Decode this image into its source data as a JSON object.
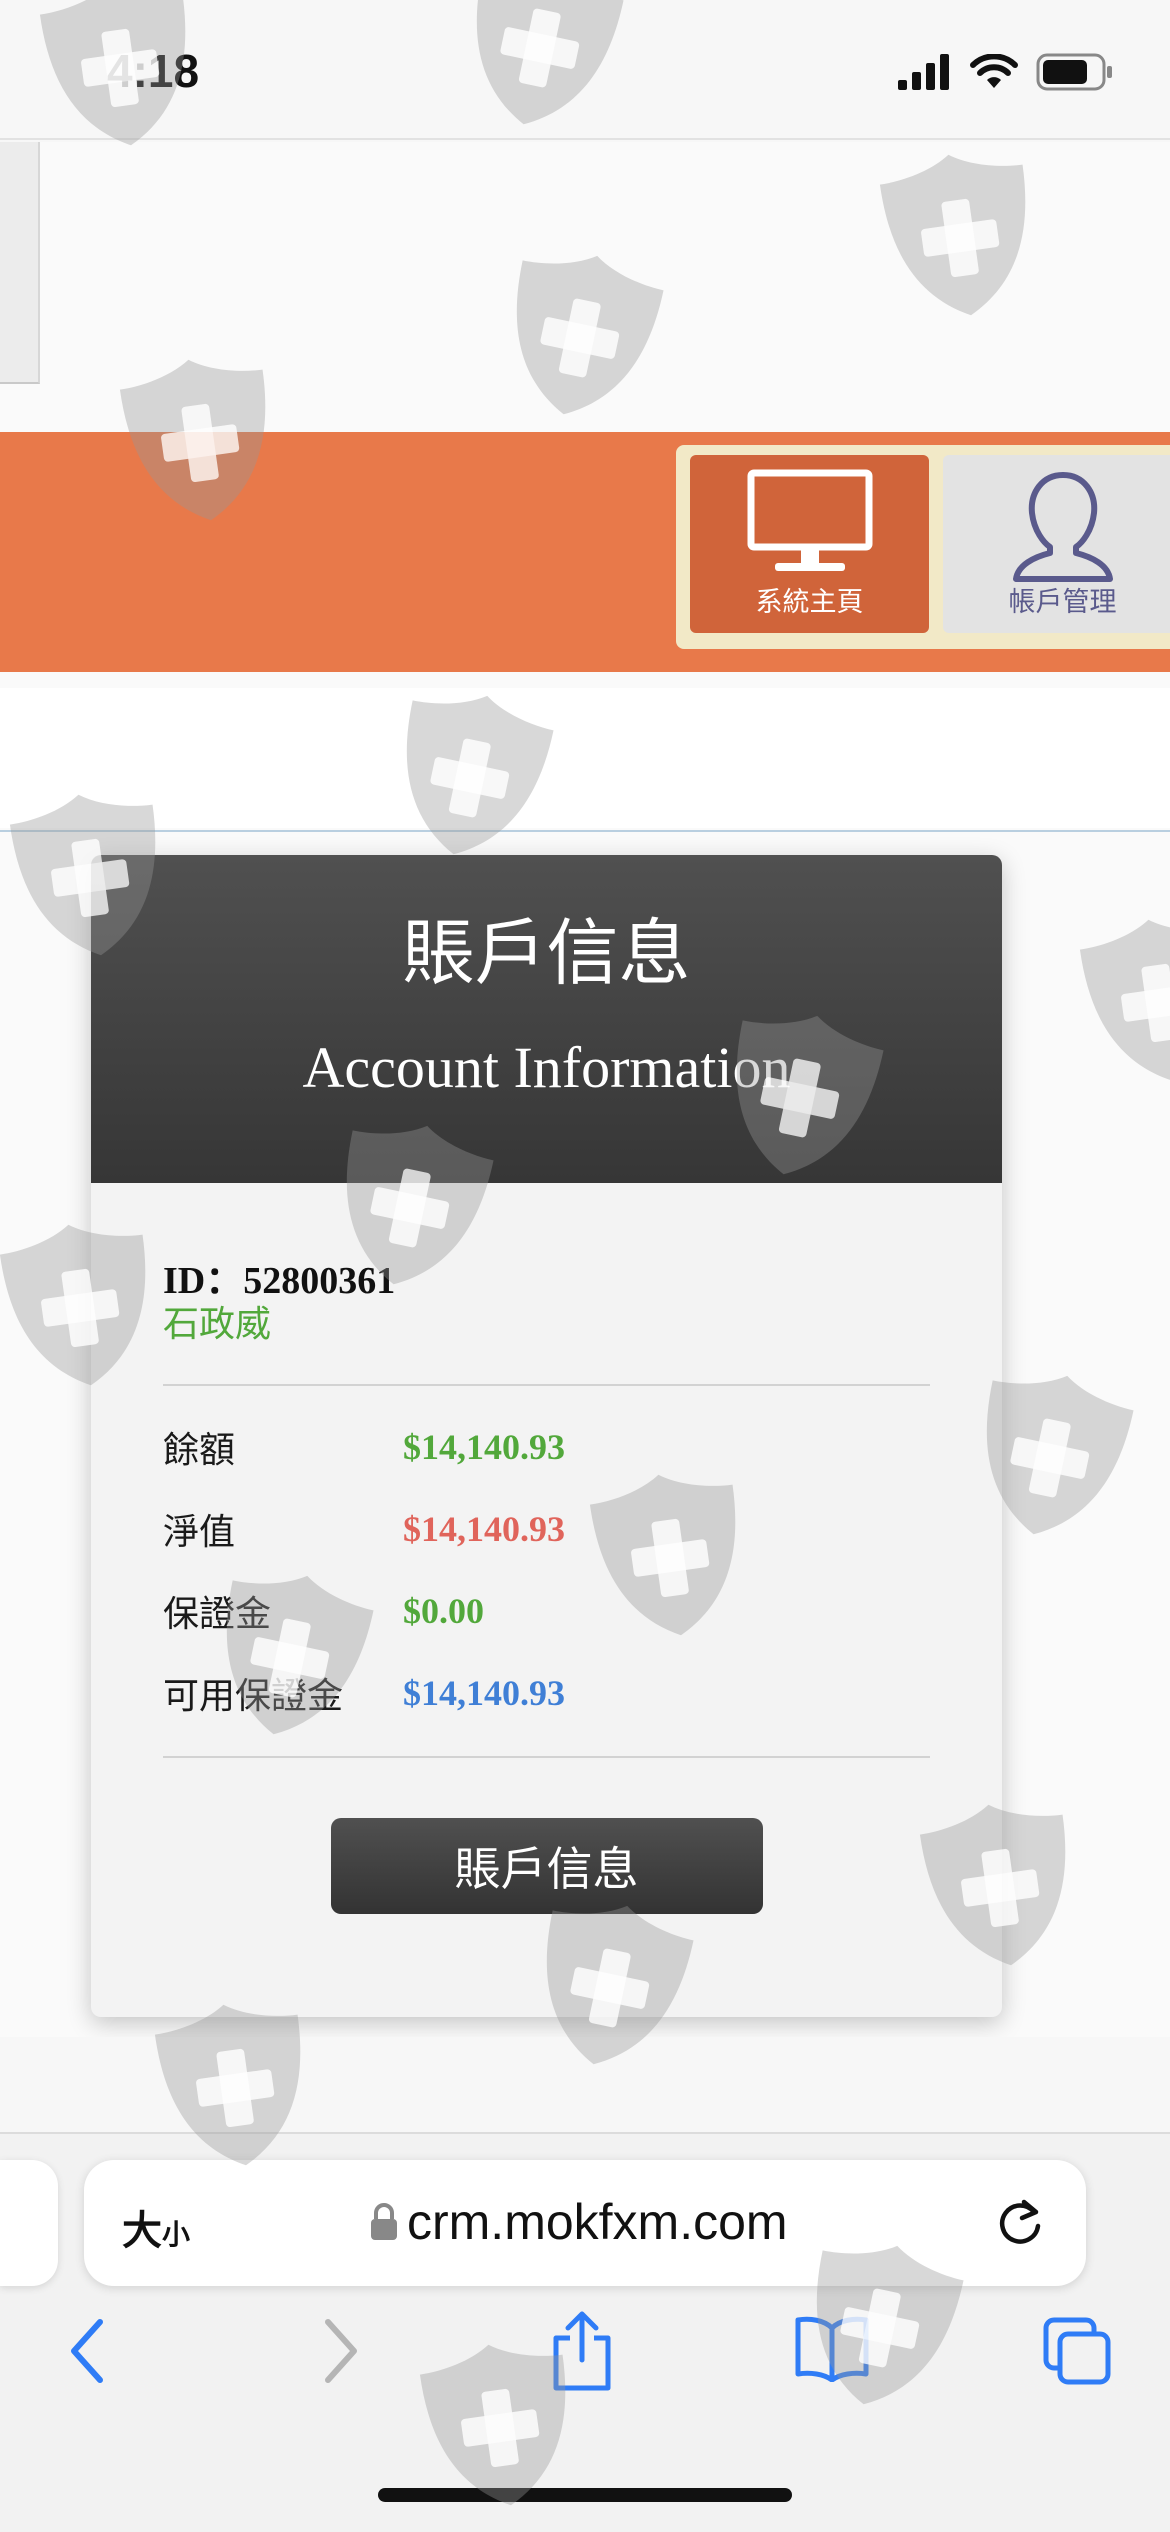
{
  "status_bar": {
    "time": "4:18"
  },
  "nav": {
    "items": [
      {
        "label": "系統主頁",
        "icon": "monitor-icon",
        "active": true
      },
      {
        "label": "帳戶管理",
        "icon": "user-icon",
        "active": false
      }
    ]
  },
  "account_card": {
    "title": "賬戶信息",
    "subtitle": "Account Information",
    "id_line": "ID：52800361",
    "name": "石政威",
    "stats": [
      {
        "label": "餘額",
        "value": "$14,140.93",
        "color": "#52a83b"
      },
      {
        "label": "淨值",
        "value": "$14,140.93",
        "color": "#e0645b"
      },
      {
        "label": "保證金",
        "value": "$0.00",
        "color": "#52a83b"
      },
      {
        "label": "可用保證金",
        "value": "$14,140.93",
        "color": "#3f7fd6"
      }
    ],
    "button_label": "賬戶信息"
  },
  "browser": {
    "size_label_big": "大",
    "size_label_small": "小",
    "url": "crm.mokfxm.com",
    "toolbar": [
      "back-icon",
      "forward-icon",
      "share-icon",
      "bookmarks-icon",
      "tabs-icon"
    ]
  },
  "colors": {
    "accent_orange": "#e8794a",
    "active_tile": "#d0643a",
    "card_header": "#404040",
    "ios_blue": "#2f7cf6"
  }
}
